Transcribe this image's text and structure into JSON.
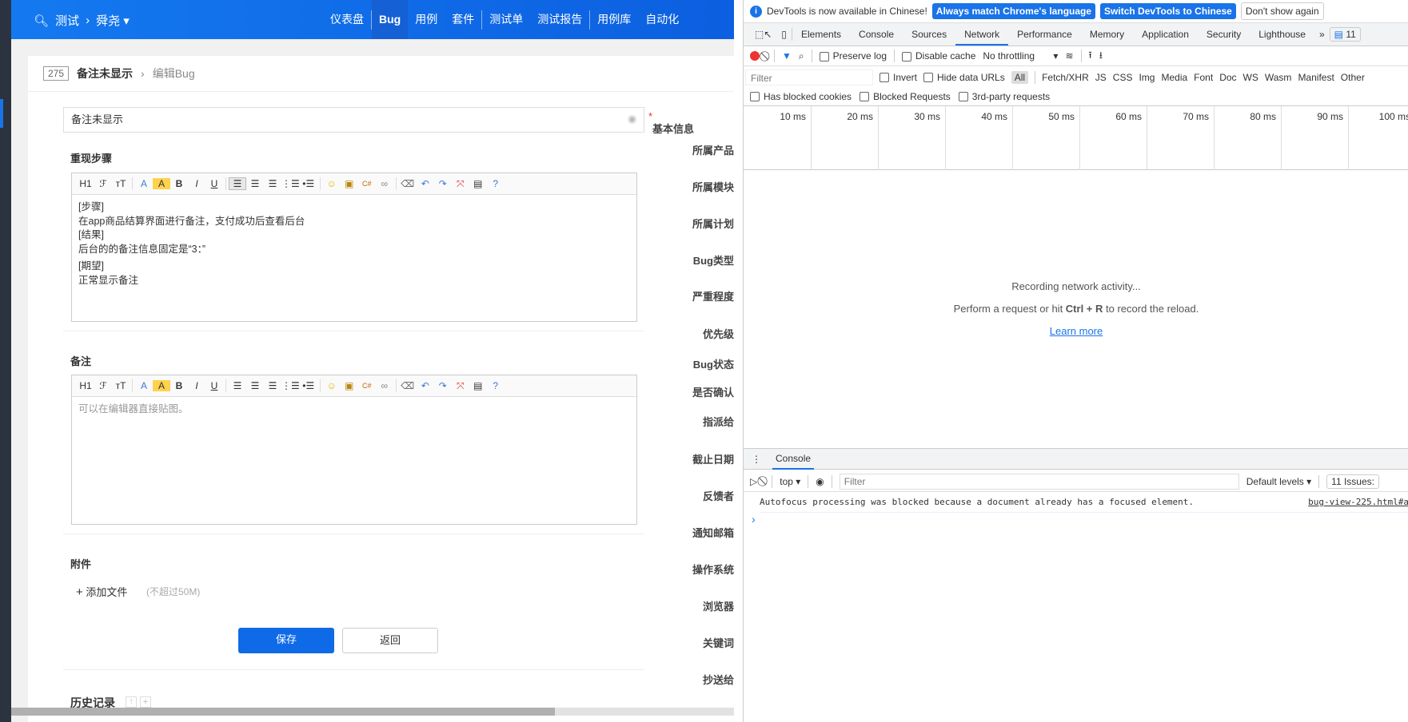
{
  "header": {
    "brand_icon": "search-icon",
    "product": "测试",
    "project": "舜尧",
    "nav": [
      "仪表盘",
      "Bug",
      "用例",
      "套件",
      "测试单",
      "测试报告",
      "用例库",
      "自动化"
    ],
    "active_nav": "Bug"
  },
  "breadcrumb": {
    "id": "275",
    "title": "备注未显示",
    "action": "编辑Bug"
  },
  "form": {
    "title_value": "备注未显示",
    "steps_label": "重现步骤",
    "steps_lines": [
      "[步骤]",
      "在app商品结算界面进行备注，支付成功后查看后台",
      "[结果]",
      "后台的的备注信息固定是“3：”",
      "[期望]",
      "正常显示备注"
    ],
    "comment_label": "备注",
    "comment_placeholder": "可以在编辑器直接贴图。",
    "toolbar": {
      "h1": "H1",
      "font": "ℱ",
      "size": "ᴛT",
      "color": "A",
      "bg": "A",
      "bold": "B",
      "italic": "I",
      "underline": "U"
    },
    "attach_label": "附件",
    "add_file": "添加文件",
    "add_file_hint": "(不超过50M)",
    "save": "保存",
    "back": "返回",
    "history": "历史记录"
  },
  "side": {
    "title": "基本信息",
    "labels": [
      "所属产品",
      "所属模块",
      "所属计划",
      "Bug类型",
      "严重程度",
      "优先级",
      "Bug状态",
      "是否确认",
      "指派给",
      "截止日期",
      "反馈者",
      "通知邮箱",
      "操作系统",
      "浏览器",
      "关键词",
      "抄送给"
    ]
  },
  "devtools": {
    "info": "DevTools is now available in Chinese!",
    "btn1": "Always match Chrome's language",
    "btn2": "Switch DevTools to Chinese",
    "btn3": "Don't show again",
    "tabs": [
      "Elements",
      "Console",
      "Sources",
      "Network",
      "Performance",
      "Memory",
      "Application",
      "Security",
      "Lighthouse"
    ],
    "active_tab": "Network",
    "issues_count": "11",
    "preserve_log": "Preserve log",
    "disable_cache": "Disable cache",
    "throttling": "No throttling",
    "filter_placeholder": "Filter",
    "invert": "Invert",
    "hide_data_urls": "Hide data URLs",
    "types": [
      "All",
      "Fetch/XHR",
      "JS",
      "CSS",
      "Img",
      "Media",
      "Font",
      "Doc",
      "WS",
      "Wasm",
      "Manifest",
      "Other"
    ],
    "blocked": [
      "Has blocked cookies",
      "Blocked Requests",
      "3rd-party requests"
    ],
    "ticks": [
      "10 ms",
      "20 ms",
      "30 ms",
      "40 ms",
      "50 ms",
      "60 ms",
      "70 ms",
      "80 ms",
      "90 ms",
      "100 ms"
    ],
    "recording": "Recording network activity...",
    "hint_pre": "Perform a request or hit ",
    "hint_key": "Ctrl + R",
    "hint_post": " to record the reload.",
    "learn_more": "Learn more",
    "console_tab": "Console",
    "context": "top",
    "console_filter": "Filter",
    "levels": "Default levels",
    "issues": "11 Issues:",
    "message": "Autofocus processing was blocked because a document already has a focused element.",
    "source": "bug-view-225.html#a",
    "prompt": "›"
  }
}
